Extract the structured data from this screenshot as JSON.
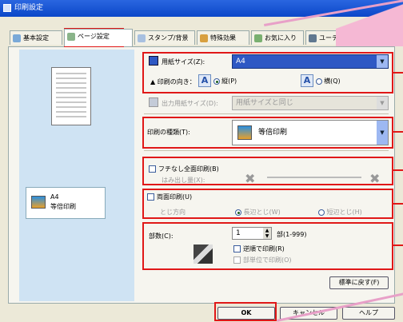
{
  "window": {
    "title": "印刷設定"
  },
  "tabs": [
    {
      "label": "基本設定",
      "icon": "basic-settings-icon"
    },
    {
      "label": "ページ設定",
      "icon": "page-setup-icon"
    },
    {
      "label": "スタンプ/背景",
      "icon": "stamp-icon"
    },
    {
      "label": "特殊効果",
      "icon": "effects-icon"
    },
    {
      "label": "お気に入り",
      "icon": "favorites-icon"
    },
    {
      "label": "ユーティリティ",
      "icon": "utility-icon"
    }
  ],
  "preview": {
    "paper_size": "A4",
    "print_type": "等倍印刷"
  },
  "paper_size": {
    "label": "用紙サイズ(Z):",
    "value": "A4"
  },
  "orientation": {
    "label": "印刷の向き：",
    "portrait": "縦(P)",
    "landscape": "横(Q)",
    "selected": "portrait"
  },
  "output_size": {
    "label": "出力用紙サイズ(D):",
    "value": "用紙サイズと同じ"
  },
  "print_type": {
    "label": "印刷の種類(T):",
    "value": "等倍印刷"
  },
  "borderless": {
    "label": "フチなし全面印刷(B)",
    "amount_label": "はみ出し量(X):"
  },
  "duplex": {
    "label": "両面印刷(U)",
    "opt1": "とじ方向",
    "opt2": "長辺とじ(W)",
    "opt3": "短辺とじ(H)"
  },
  "copies": {
    "label": "部数(C):",
    "value": "1",
    "range": "部(1-999)",
    "reverse": "逆順で印刷(R)",
    "collate": "部単位で印刷(O)"
  },
  "buttons": {
    "defaults": "標準に戻す(F)",
    "ok": "OK",
    "cancel": "キャンセル",
    "help": "ヘルプ"
  },
  "colors": {
    "highlight": "#e01818",
    "accent": "#2e58c4"
  }
}
